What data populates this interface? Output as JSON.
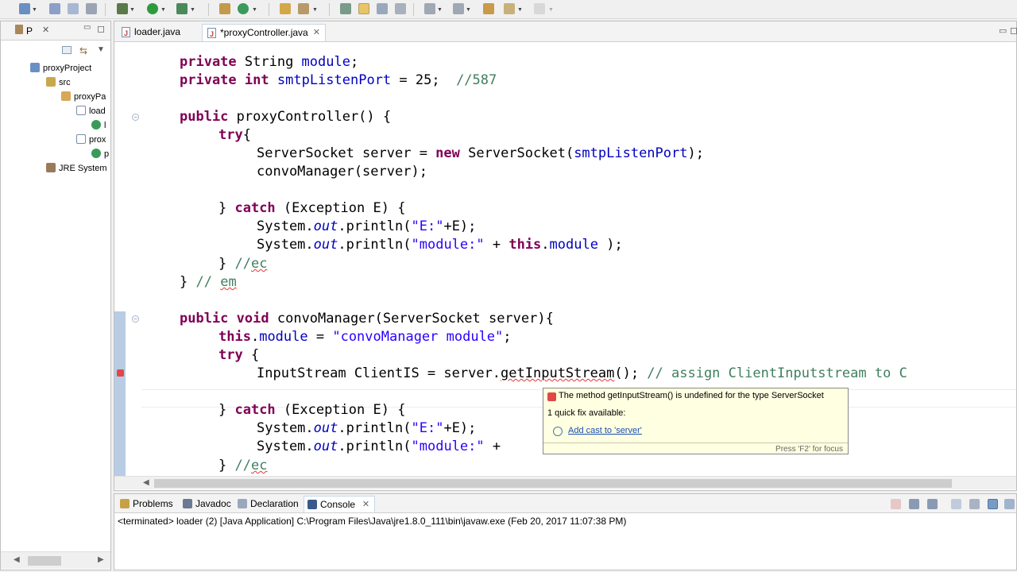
{
  "editor": {
    "tabs": [
      {
        "label": "loader.java"
      },
      {
        "label": "*proxyController.java"
      }
    ]
  },
  "explorer": {
    "tab_label": "P",
    "tree": [
      "proxyProject",
      "src",
      "proxyPa",
      "load",
      "l",
      "prox",
      "p",
      "JRE System"
    ]
  },
  "code": {
    "l1": {
      "kw": "private",
      "t1": " String ",
      "f": "module",
      "t2": ";"
    },
    "l2": {
      "kw1": "private",
      "sp": " ",
      "kw2": "int",
      "sp2": " ",
      "f": "smtpListenPort",
      "t": " = 25;  ",
      "c": "//587"
    },
    "l3": {
      "kw": "public",
      "t": " proxyController() {"
    },
    "l4": {
      "kw": "try",
      "t": "{"
    },
    "l5": {
      "t1": "ServerSocket server = ",
      "kw": "new",
      "t2": " ServerSocket(",
      "f": "smtpListenPort",
      "t3": ");"
    },
    "l6": {
      "t": "convoManager(server);"
    },
    "l7": {
      "t1": "} ",
      "kw": "catch",
      "t2": " (Exception E) {"
    },
    "l8": {
      "t1": "System.",
      "i": "out",
      "t2": ".println(",
      "s": "\"E:\"",
      "t3": "+E);"
    },
    "l9": {
      "t1": "System.",
      "i": "out",
      "t2": ".println(",
      "s": "\"module:\"",
      "t3": " + ",
      "kw": "this",
      "t4": ".",
      "f": "module",
      "t5": " );"
    },
    "l10": {
      "t": "} ",
      "c1": "//",
      "c2": "ec"
    },
    "l11": {
      "t": "} ",
      "c1": "// ",
      "c2": "em"
    },
    "l12": {
      "kw1": "public",
      "sp": " ",
      "kw2": "void",
      "t": " convoManager(ServerSocket server){"
    },
    "l13": {
      "kw": "this",
      "t1": ".",
      "f": "module",
      "t2": " = ",
      "s": "\"convoManager module\"",
      "t3": ";"
    },
    "l14": {
      "kw": "try",
      "t": " {"
    },
    "l15": {
      "t1": "InputStream ClientIS = server.",
      "err": "getInputStream",
      "t2": "(); ",
      "c": "// assign ClientInputstream to C"
    },
    "l16": {
      "t1": "} ",
      "kw": "catch",
      "t2": " (Exception E) {"
    },
    "l17": {
      "t1": "System.",
      "i": "out",
      "t2": ".println(",
      "s": "\"E:\"",
      "t3": "+E);"
    },
    "l18": {
      "t1": "System.",
      "i": "out",
      "t2": ".println(",
      "s": "\"module:\"",
      "t3": " +"
    },
    "l19": {
      "t": "} ",
      "c1": "//",
      "c2": "ec"
    }
  },
  "popup": {
    "message": "The method getInputStream() is undefined for the type ServerSocket",
    "quickfix_count": "1 quick fix available:",
    "fix": "Add cast to 'server'",
    "footer": "Press 'F2' for focus"
  },
  "console": {
    "tabs": [
      {
        "label": "Problems"
      },
      {
        "label": "Javadoc"
      },
      {
        "label": "Declaration"
      },
      {
        "label": "Console"
      }
    ],
    "output": "<terminated> loader (2) [Java Application] C:\\Program Files\\Java\\jre1.8.0_111\\bin\\javaw.exe (Feb 20, 2017 11:07:38 PM)"
  }
}
